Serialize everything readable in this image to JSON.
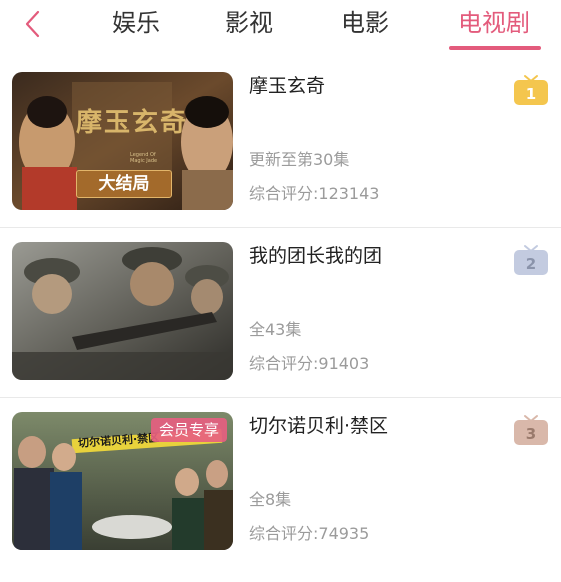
{
  "nav": {
    "tabs": [
      {
        "label": "娱乐"
      },
      {
        "label": "影视"
      },
      {
        "label": "电影"
      },
      {
        "label": "电视剧"
      }
    ]
  },
  "list": [
    {
      "title": "摩玉玄奇",
      "status": "更新至第30集",
      "rating": "综合评分:123143",
      "rank": "1",
      "poster_text": "摩玉玄奇",
      "poster_subtitle": "Legend Of Magic Jade",
      "poster_banner": "大结局",
      "rank_color": "#f4c64e"
    },
    {
      "title": "我的团长我的团",
      "status": "全43集",
      "rating": "综合评分:91403",
      "rank": "2",
      "rank_color": "#c3cbe0"
    },
    {
      "title": "切尔诺贝利·禁区",
      "status": "全8集",
      "rating": "综合评分:74935",
      "rank": "3",
      "vip_label": "会员专享",
      "poster_text": "切尔诺贝利·禁区",
      "rank_color": "#d9b8aa"
    }
  ],
  "colors": {
    "accent": "#e35b7c"
  }
}
